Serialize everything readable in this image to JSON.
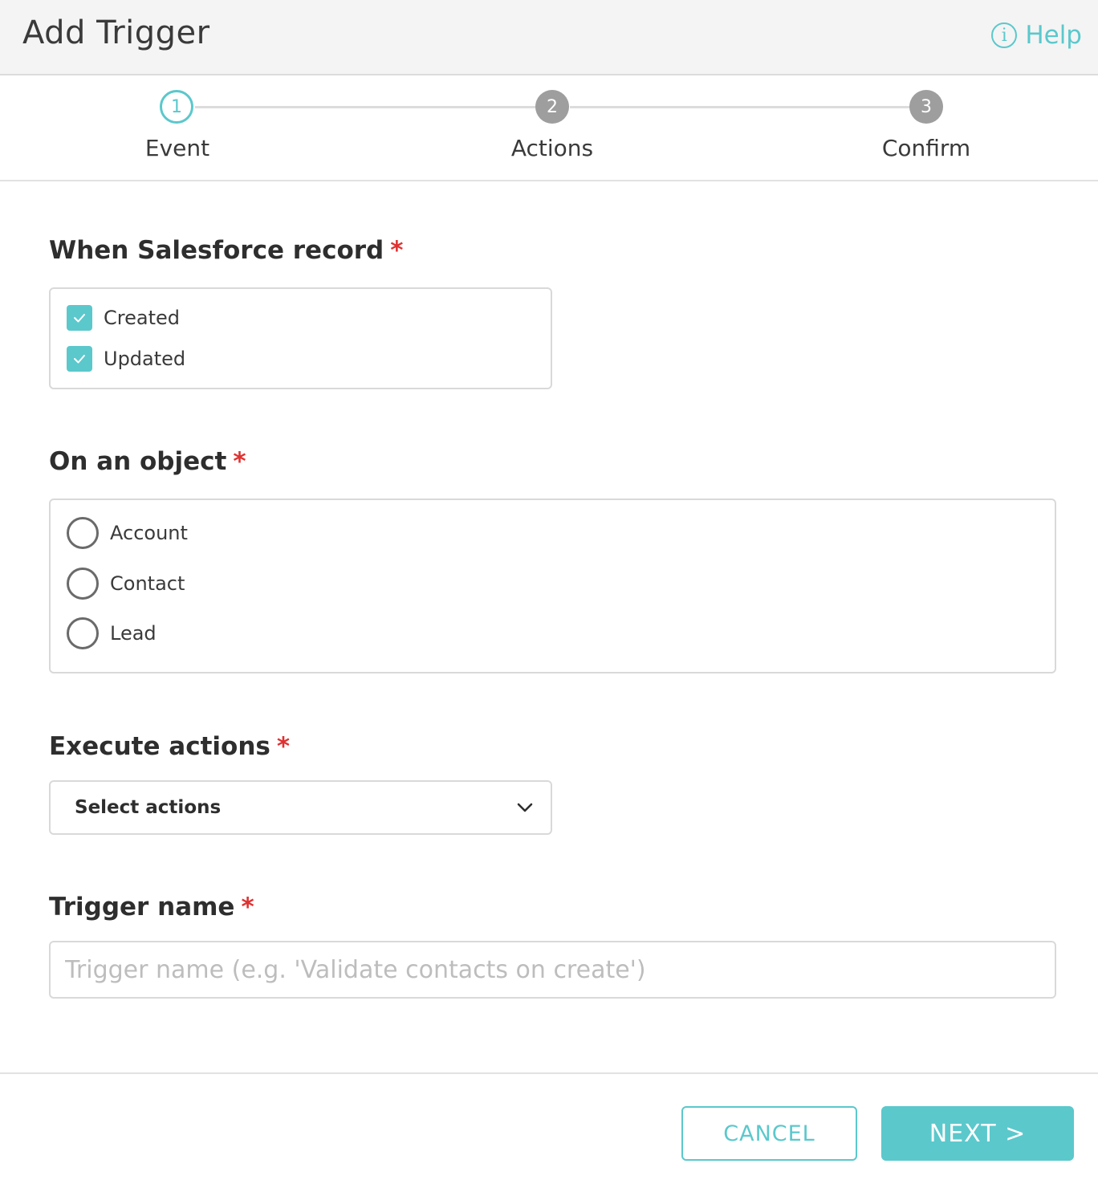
{
  "header": {
    "title": "Add Trigger",
    "help_label": "Help",
    "help_icon": "info-icon"
  },
  "stepper": {
    "steps": [
      {
        "number": "1",
        "label": "Event",
        "state": "active"
      },
      {
        "number": "2",
        "label": "Actions",
        "state": "inactive"
      },
      {
        "number": "3",
        "label": "Confirm",
        "state": "inactive"
      }
    ]
  },
  "record_section": {
    "label": "When Salesforce record",
    "required_mark": "*",
    "options": [
      {
        "label": "Created",
        "checked": true
      },
      {
        "label": "Updated",
        "checked": true
      }
    ]
  },
  "object_section": {
    "label": "On an object",
    "required_mark": "*",
    "options": [
      {
        "label": "Account",
        "selected": false
      },
      {
        "label": "Contact",
        "selected": false
      },
      {
        "label": "Lead",
        "selected": false
      }
    ]
  },
  "actions_section": {
    "label": "Execute actions",
    "required_mark": "*",
    "select_value": "Select actions"
  },
  "name_section": {
    "label": "Trigger name",
    "required_mark": "*",
    "value": "",
    "placeholder": "Trigger name (e.g. 'Validate contacts on create')"
  },
  "footer": {
    "cancel_label": "CANCEL",
    "next_label": "NEXT >"
  },
  "colors": {
    "accent": "#5bc8cc",
    "required": "#e03131",
    "step_inactive": "#9e9e9e"
  }
}
